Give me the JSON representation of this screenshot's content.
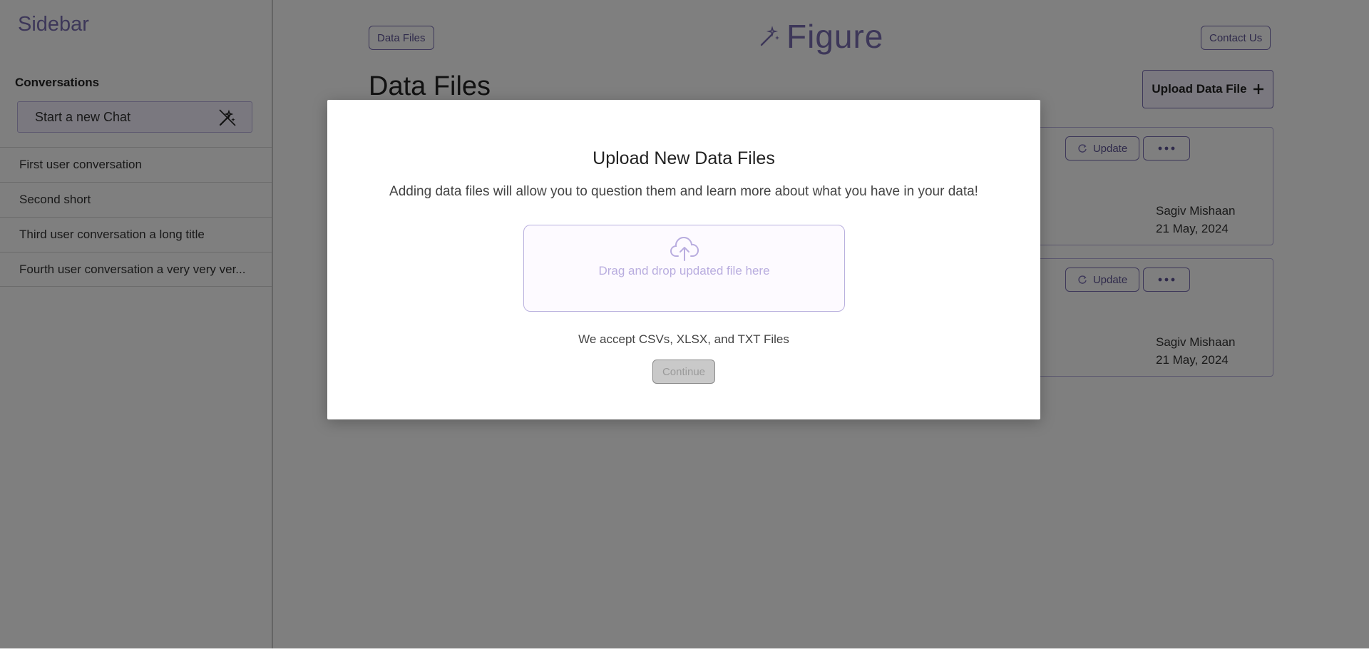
{
  "sidebar": {
    "title": "Sidebar",
    "conversations_heading": "Conversations",
    "new_chat_label": "Start a new Chat",
    "conversations": [
      {
        "label": "First user conversation"
      },
      {
        "label": "Second short"
      },
      {
        "label": "Third user conversation a long title"
      },
      {
        "label": "Fourth user conversation a very very ver..."
      }
    ]
  },
  "header": {
    "breadcrumb": "Data Files",
    "logo_text": "Figure",
    "contact_label": "Contact Us"
  },
  "main": {
    "title": "Data Files",
    "upload_label": "Upload Data File",
    "cards": [
      {
        "update_label": "Update",
        "owner": "Sagiv Mishaan",
        "date": "21 May, 2024"
      },
      {
        "update_label": "Update",
        "owner": "Sagiv Mishaan",
        "date": "21 May, 2024"
      }
    ]
  },
  "modal": {
    "title": "Upload New Data Files",
    "description": "Adding data files will allow you to question them and learn more about what you have in your data!",
    "dropzone_text": "Drag and drop updated file here",
    "accept_text": "We accept CSVs, XLSX, and TXT Files",
    "continue_label": "Continue"
  },
  "icons": {
    "new_chat": "magic-wand-icon",
    "logo": "magic-wand-icon",
    "upload": "plus-icon",
    "update": "refresh-icon",
    "more": "more-horizontal-icon",
    "dropzone": "cloud-upload-icon"
  },
  "colors": {
    "accent": "#7a6fb3",
    "accent_light": "#f4f1ff",
    "overlay": "rgba(0,0,0,0.5)"
  }
}
